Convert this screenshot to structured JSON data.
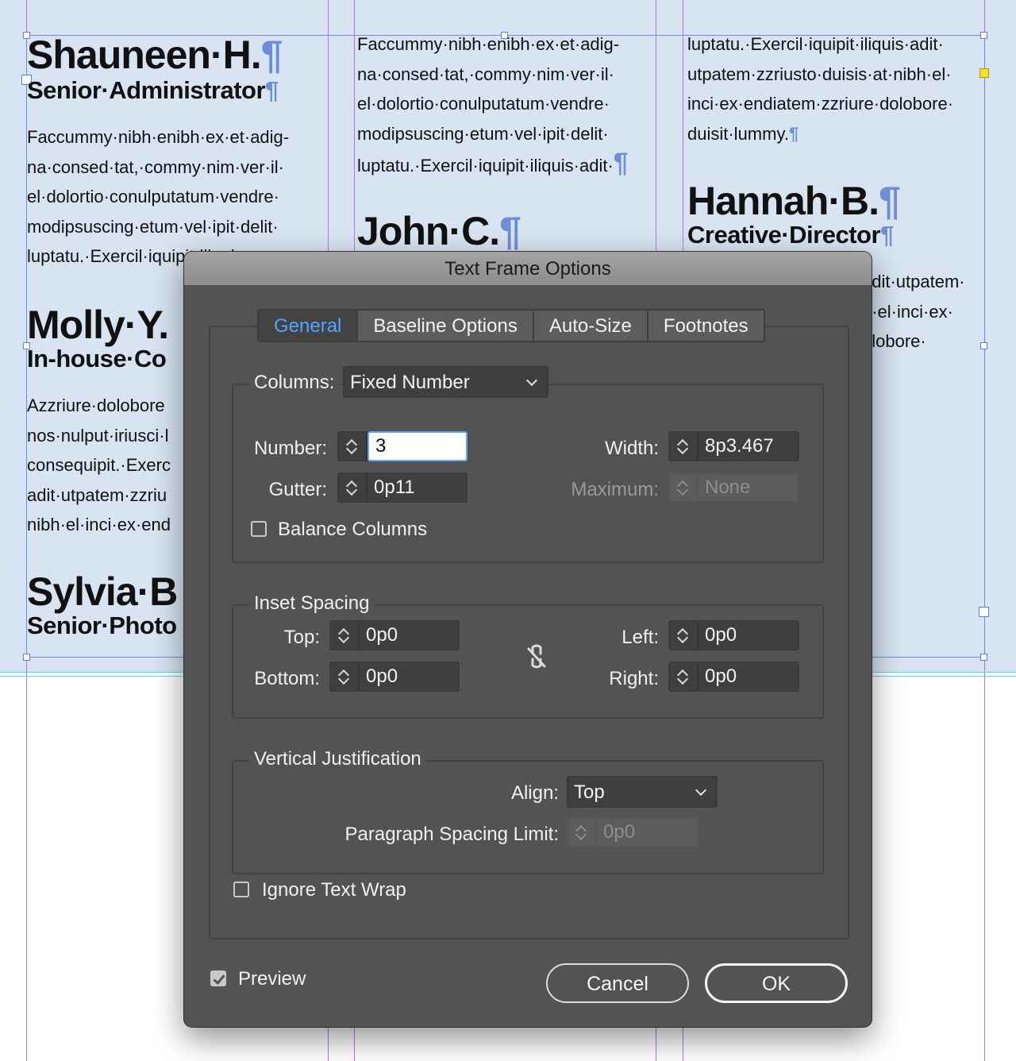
{
  "document": {
    "col1": {
      "name": "Shauneen·H.",
      "role": "Senior·Administrator",
      "body": "Faccummy·nibh·enibh·ex·et·adig-\nna·consed·tat,·commy·nim·ver·il·\nel·dolortio·conulputatum·vendre·\nmodipsuscing·etum·vel·ipit·delit·\nluptatu.·Exercil·iquipit·iliquis·",
      "name2": "Molly·Y.",
      "role2": "In-house·Co",
      "body2": "Azzriure·dolobore\nnos·nulput·iriusci·l\nconsequipit.·Exerc\nadit·utpatem·zzriu\nnibh·el·inci·ex·end",
      "name3": "Sylvia·B",
      "role3": "Senior·Photo"
    },
    "col2": {
      "body": "Faccummy·nibh·enibh·ex·et·adig-\nna·consed·tat,·commy·nim·ver·il·\nel·dolortio·conulputatum·vendre·\nmodipsuscing·etum·vel·ipit·delit·\nluptatu.·Exercil·iquipit·iliquis·adit·",
      "name": "John·C."
    },
    "col3": {
      "body": "luptatu.·Exercil·iquipit·iliquis·adit·\nutpatem·zzriusto·duisis·at·nibh·el·\ninci·ex·endiatem·zzriure·dolobore·\nduisit·lummy.",
      "name": "Hannah·B.",
      "role": "Creative·Director",
      "body2": "adit·utpatem·\nn·el·inci·ex·\nolobore·"
    },
    "pilcrow": "¶"
  },
  "dialog": {
    "title": "Text Frame Options",
    "tabs": [
      {
        "label": "General",
        "active": true
      },
      {
        "label": "Baseline Options",
        "active": false
      },
      {
        "label": "Auto-Size",
        "active": false
      },
      {
        "label": "Footnotes",
        "active": false
      }
    ],
    "columns": {
      "label": "Columns:",
      "type": "Fixed Number",
      "number_label": "Number:",
      "number": "3",
      "width_label": "Width:",
      "width": "8p3.467",
      "gutter_label": "Gutter:",
      "gutter": "0p11",
      "maximum_label": "Maximum:",
      "maximum": "None",
      "balance_label": "Balance Columns",
      "balance_checked": false
    },
    "inset": {
      "legend": "Inset Spacing",
      "top_label": "Top:",
      "top": "0p0",
      "bottom_label": "Bottom:",
      "bottom": "0p0",
      "left_label": "Left:",
      "left": "0p0",
      "right_label": "Right:",
      "right": "0p0",
      "link_icon": "unlink-icon"
    },
    "vertical": {
      "legend": "Vertical Justification",
      "align_label": "Align:",
      "align": "Top",
      "psl_label": "Paragraph Spacing Limit:",
      "psl": "0p0"
    },
    "ignore_wrap_label": "Ignore Text Wrap",
    "ignore_wrap_checked": false,
    "preview_label": "Preview",
    "preview_checked": true,
    "cancel_label": "Cancel",
    "ok_label": "OK"
  },
  "colors": {
    "frame_bg": "#d8e4f1",
    "guide_purple": "#b27ad6",
    "guide_cyan": "#55d4e6",
    "frame_blue": "#6d8ed6",
    "dialog_bg": "#535353",
    "active_tab": "#4ea6ff"
  }
}
